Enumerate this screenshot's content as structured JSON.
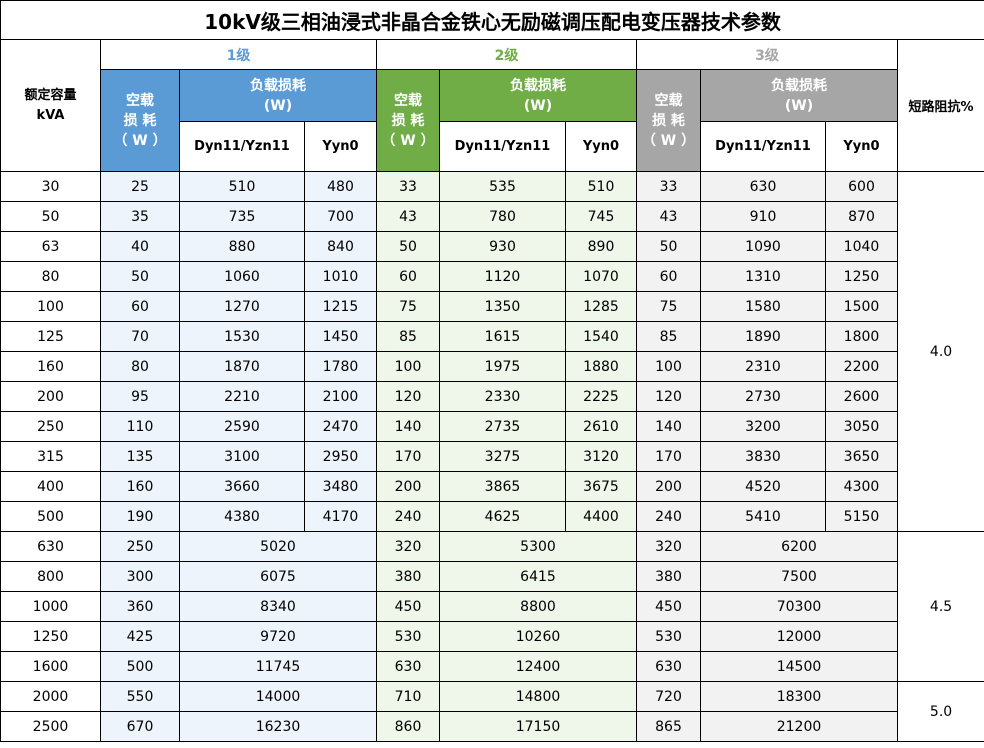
{
  "title": "10kV级三相油浸式非晶合金铁心无励磁调压配电变压器技术参数",
  "headers": {
    "rated_capacity": "额定容量",
    "rated_unit": "kVA",
    "level1": "1级",
    "level2": "2级",
    "level3": "3级",
    "no_load_1": "空载",
    "no_load_2": "损 耗",
    "no_load_3": "（ W ）",
    "load_loss_1": "负载损耗",
    "load_loss_2": "(W)",
    "dyn": "Dyn11/Yzn11",
    "yyn": "Yyn0",
    "short_circuit": "短路阻抗%"
  },
  "colors": {
    "level1": "#5b9bd5",
    "level2": "#70ad47",
    "level3": "#a6a6a6"
  },
  "rows_split": [
    [
      "30",
      "25",
      "510",
      "480",
      "33",
      "535",
      "510",
      "33",
      "630",
      "600"
    ],
    [
      "50",
      "35",
      "735",
      "700",
      "43",
      "780",
      "745",
      "43",
      "910",
      "870"
    ],
    [
      "63",
      "40",
      "880",
      "840",
      "50",
      "930",
      "890",
      "50",
      "1090",
      "1040"
    ],
    [
      "80",
      "50",
      "1060",
      "1010",
      "60",
      "1120",
      "1070",
      "60",
      "1310",
      "1250"
    ],
    [
      "100",
      "60",
      "1270",
      "1215",
      "75",
      "1350",
      "1285",
      "75",
      "1580",
      "1500"
    ],
    [
      "125",
      "70",
      "1530",
      "1450",
      "85",
      "1615",
      "1540",
      "85",
      "1890",
      "1800"
    ],
    [
      "160",
      "80",
      "1870",
      "1780",
      "100",
      "1975",
      "1880",
      "100",
      "2310",
      "2200"
    ],
    [
      "200",
      "95",
      "2210",
      "2100",
      "120",
      "2330",
      "2225",
      "120",
      "2730",
      "2600"
    ],
    [
      "250",
      "110",
      "2590",
      "2470",
      "140",
      "2735",
      "2610",
      "140",
      "3200",
      "3050"
    ],
    [
      "315",
      "135",
      "3100",
      "2950",
      "170",
      "3275",
      "3120",
      "170",
      "3830",
      "3650"
    ],
    [
      "400",
      "160",
      "3660",
      "3480",
      "200",
      "3865",
      "3675",
      "200",
      "4520",
      "4300"
    ],
    [
      "500",
      "190",
      "4380",
      "4170",
      "240",
      "4625",
      "4400",
      "240",
      "5410",
      "5150"
    ]
  ],
  "rows_merged": [
    [
      "630",
      "250",
      "5020",
      "320",
      "5300",
      "320",
      "6200"
    ],
    [
      "800",
      "300",
      "6075",
      "380",
      "6415",
      "380",
      "7500"
    ],
    [
      "1000",
      "360",
      "8340",
      "450",
      "8800",
      "450",
      "70300"
    ],
    [
      "1250",
      "425",
      "9720",
      "530",
      "10260",
      "530",
      "12000"
    ],
    [
      "1600",
      "500",
      "11745",
      "630",
      "12400",
      "630",
      "14500"
    ],
    [
      "2000",
      "550",
      "14000",
      "710",
      "14800",
      "720",
      "18300"
    ],
    [
      "2500",
      "670",
      "16230",
      "860",
      "17150",
      "865",
      "21200"
    ]
  ],
  "impedance": [
    "4.0",
    "4.5",
    "5.0"
  ]
}
